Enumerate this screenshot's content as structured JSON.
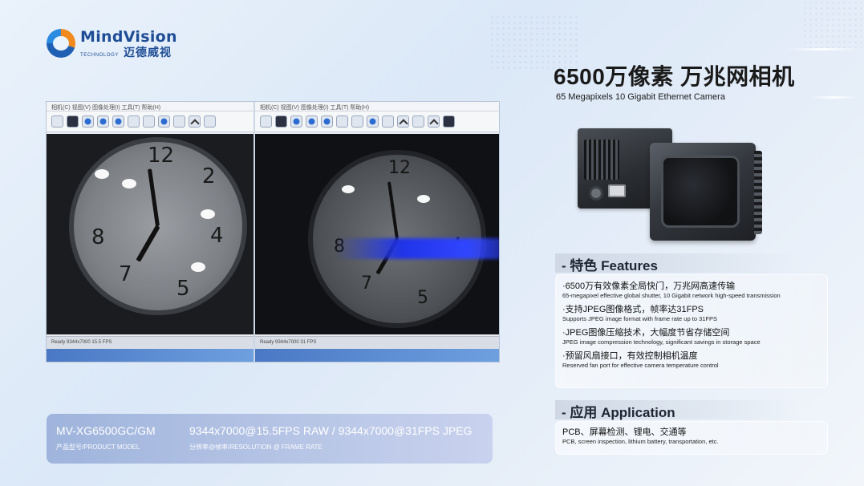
{
  "brand": {
    "name_en": "MindVision",
    "tagline": "TECHNOLOGY",
    "name_cn": "迈德威视"
  },
  "header": {
    "title_cn": "6500万像素 万兆网相机",
    "title_en": "65 Megapixels 10 Gigabit Ethernet Camera"
  },
  "demo": {
    "menubar_left": "相机(C)  视图(V)  图像处理(I)  工具(T)  帮助(H)",
    "menubar_right": "相机(C)  视图(V)  图像处理(I)  工具(T)  帮助(H)",
    "status_left": "Ready  9344x7000  15.5 FPS",
    "status_right": "Ready  9344x7000  31 FPS"
  },
  "spec": {
    "model": "MV-XG6500GC/GM",
    "model_label": "产品型号/PRODUCT MODEL",
    "resolution": "9344x7000@15.5FPS RAW / 9344x7000@31FPS JPEG",
    "resolution_label": "分辨率@帧率/RESOLUTION @ FRAME RATE"
  },
  "features": {
    "header": "- 特色 Features",
    "items": [
      {
        "cn": "·6500万有效像素全局快门，万兆网高速传输",
        "en": "65-megapixel effective global shutter, 10 Gigabit network high-speed transmission"
      },
      {
        "cn": "·支持JPEG图像格式，帧率达31FPS",
        "en": "Supports JPEG image format with frame rate up to 31FPS"
      },
      {
        "cn": "·JPEG图像压缩技术，大幅度节省存储空间",
        "en": "JPEG image compression technology, significant savings in storage space"
      },
      {
        "cn": "·预留风扇接口，有效控制相机温度",
        "en": "Reserved fan port for effective camera temperature control"
      }
    ]
  },
  "application": {
    "header": "- 应用 Application",
    "cn": "PCB、屏幕检测、锂电、交通等",
    "en": "PCB, screen inspection, lithium battery, transportation, etc."
  }
}
